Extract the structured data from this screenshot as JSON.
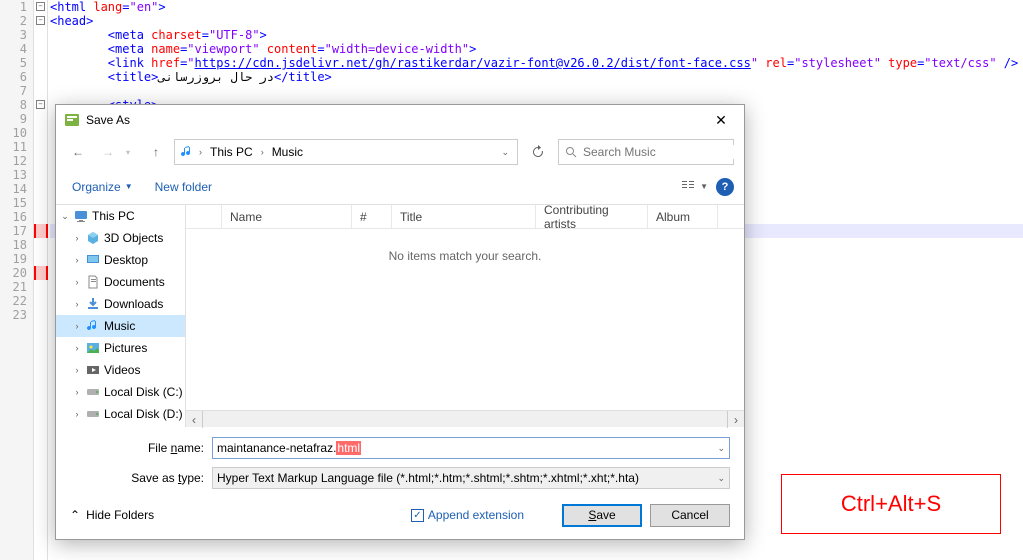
{
  "code": {
    "lines": [
      {
        "n": 1,
        "tokens": [
          {
            "c": "t-blue",
            "t": "<html "
          },
          {
            "c": "t-red",
            "t": "lang"
          },
          {
            "c": "t-blue",
            "t": "="
          },
          {
            "c": "t-purple",
            "t": "\"en\""
          },
          {
            "c": "t-blue",
            "t": ">"
          }
        ]
      },
      {
        "n": 2,
        "tokens": [
          {
            "c": "t-blue",
            "t": "<head>"
          }
        ]
      },
      {
        "n": 3,
        "indent": 2,
        "tokens": [
          {
            "c": "t-blue",
            "t": "<meta "
          },
          {
            "c": "t-red",
            "t": "charset"
          },
          {
            "c": "t-blue",
            "t": "="
          },
          {
            "c": "t-purple",
            "t": "\"UTF-8\""
          },
          {
            "c": "t-blue",
            "t": ">"
          }
        ]
      },
      {
        "n": 4,
        "indent": 2,
        "tokens": [
          {
            "c": "t-blue",
            "t": "<meta "
          },
          {
            "c": "t-red",
            "t": "name"
          },
          {
            "c": "t-blue",
            "t": "="
          },
          {
            "c": "t-purple",
            "t": "\"viewport\""
          },
          {
            "c": "t-blue",
            "t": " "
          },
          {
            "c": "t-red",
            "t": "content"
          },
          {
            "c": "t-blue",
            "t": "="
          },
          {
            "c": "t-purple",
            "t": "\"width=device-width\""
          },
          {
            "c": "t-blue",
            "t": ">"
          }
        ]
      },
      {
        "n": 5,
        "indent": 2,
        "tokens": [
          {
            "c": "t-blue",
            "t": "<link "
          },
          {
            "c": "t-red",
            "t": "href"
          },
          {
            "c": "t-blue",
            "t": "="
          },
          {
            "c": "t-purple",
            "t": "\""
          },
          {
            "c": "t-link",
            "t": "https://cdn.jsdelivr.net/gh/rastikerdar/vazir-font@v26.0.2/dist/font-face.css"
          },
          {
            "c": "t-purple",
            "t": "\""
          },
          {
            "c": "t-blue",
            "t": " "
          },
          {
            "c": "t-red",
            "t": "rel"
          },
          {
            "c": "t-blue",
            "t": "="
          },
          {
            "c": "t-purple",
            "t": "\"stylesheet\""
          },
          {
            "c": "t-blue",
            "t": " "
          },
          {
            "c": "t-red",
            "t": "type"
          },
          {
            "c": "t-blue",
            "t": "="
          },
          {
            "c": "t-purple",
            "t": "\"text/css\""
          },
          {
            "c": "t-blue",
            "t": " />"
          }
        ]
      },
      {
        "n": 6,
        "indent": 2,
        "tokens": [
          {
            "c": "t-blue",
            "t": "<title>"
          },
          {
            "c": "t-black",
            "t": "در حال بروزرسانی"
          },
          {
            "c": "t-blue",
            "t": "</title>"
          }
        ]
      },
      {
        "n": 7,
        "tokens": []
      },
      {
        "n": 8,
        "indent": 2,
        "tokens": [
          {
            "c": "t-blue",
            "t": "<style>"
          }
        ]
      }
    ],
    "extra_gutter": [
      9,
      10,
      11,
      12,
      13,
      14,
      15,
      16,
      17,
      18,
      19,
      20,
      21,
      22,
      23
    ]
  },
  "dialog": {
    "title": "Save As",
    "breadcrumbs": [
      "This PC",
      "Music"
    ],
    "search_placeholder": "Search Music",
    "organize": "Organize",
    "new_folder": "New folder",
    "columns": {
      "name": "Name",
      "num": "#",
      "title": "Title",
      "artist": "Contributing artists",
      "album": "Album"
    },
    "empty": "No items match your search.",
    "tree": [
      {
        "label": "This PC",
        "icon": "pc",
        "exp": "v",
        "lvl": 0
      },
      {
        "label": "3D Objects",
        "icon": "3d",
        "exp": ">",
        "lvl": 1
      },
      {
        "label": "Desktop",
        "icon": "desktop",
        "exp": ">",
        "lvl": 1
      },
      {
        "label": "Documents",
        "icon": "doc",
        "exp": ">",
        "lvl": 1
      },
      {
        "label": "Downloads",
        "icon": "dl",
        "exp": ">",
        "lvl": 1
      },
      {
        "label": "Music",
        "icon": "music",
        "exp": ">",
        "lvl": 1,
        "sel": true
      },
      {
        "label": "Pictures",
        "icon": "pic",
        "exp": ">",
        "lvl": 1
      },
      {
        "label": "Videos",
        "icon": "vid",
        "exp": ">",
        "lvl": 1
      },
      {
        "label": "Local Disk (C:)",
        "icon": "disk",
        "exp": ">",
        "lvl": 1
      },
      {
        "label": "Local Disk (D:)",
        "icon": "disk",
        "exp": ">",
        "lvl": 1
      }
    ],
    "filename_label": "File name:",
    "filename_underline": "n",
    "filename_value": "maintanance-netafraz.",
    "filename_hl": "html",
    "saveas_label": "Save as type:",
    "saveas_underline": "t",
    "saveas_value": "Hyper Text Markup Language file (*.html;*.htm;*.shtml;*.shtm;*.xhtml;*.xht;*.hta)",
    "append": "Append extension",
    "append_underline": "A",
    "save": "Save",
    "save_underline": "S",
    "cancel": "Cancel",
    "hide_folders": "Hide Folders"
  },
  "shortcut": "Ctrl+Alt+S"
}
